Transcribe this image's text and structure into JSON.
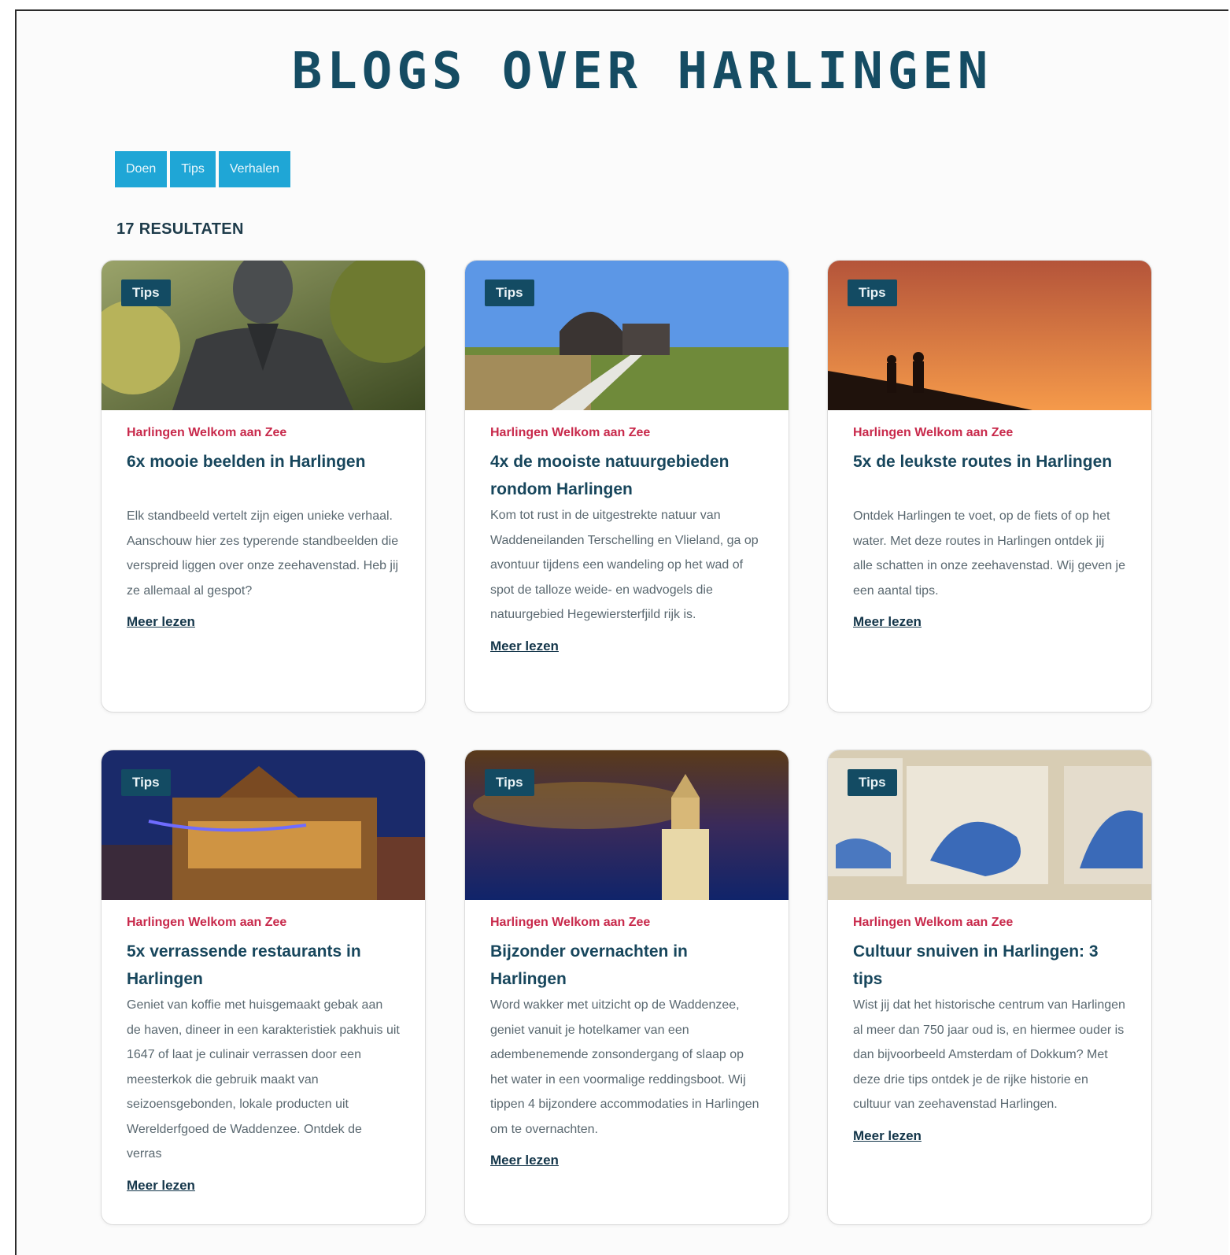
{
  "page": {
    "title": "BLOGS OVER HARLINGEN"
  },
  "filters": [
    "Doen",
    "Tips",
    "Verhalen"
  ],
  "results": {
    "count_label": "17 RESULTATEN"
  },
  "cards": [
    {
      "badge": "Tips",
      "category": "Harlingen Welkom aan Zee",
      "title": "6x mooie beelden in Harlingen",
      "description": "Elk standbeeld vertelt zijn eigen unieke verhaal. Aanschouw hier zes typerende standbeelden die verspreid liggen over onze zeehavenstad. Heb jij ze allemaal al gespot?",
      "link": "Meer lezen",
      "image": "bronze-statue"
    },
    {
      "badge": "Tips",
      "category": "Harlingen Welkom aan Zee",
      "title": "4x de mooiste natuurgebieden rondom Harlingen",
      "description": "Kom tot rust in de uitgestrekte natuur van Waddeneilanden Terschelling en Vlieland, ga op avontuur tijdens een wandeling op het wad of spot de talloze weide- en wadvogels die natuurgebied Hegewiersterfjild rijk is.",
      "link": "Meer lezen",
      "image": "nature-pavilion"
    },
    {
      "badge": "Tips",
      "category": "Harlingen Welkom aan Zee",
      "title": "5x de leukste routes in Harlingen",
      "description": "Ontdek Harlingen te voet, op de fiets of op het water. Met deze routes in Harlingen ontdek jij alle schatten in onze zeehavenstad. Wij geven je een aantal tips.",
      "link": "Meer lezen",
      "image": "sunset-walkers"
    },
    {
      "badge": "Tips",
      "category": "Harlingen Welkom aan Zee",
      "title": "5x verrassende restaurants in Harlingen",
      "description": "Geniet van koffie met huisgemaakt gebak aan de haven, dineer in een karakteristiek pakhuis uit 1647 of laat je culinair verrassen door een meesterkok die gebruik maakt van seizoensgebonden, lokale producten uit Werelderfgoed de Waddenzee. Ontdek de verras",
      "link": "Meer lezen",
      "image": "night-buildings"
    },
    {
      "badge": "Tips",
      "category": "Harlingen Welkom aan Zee",
      "title": "Bijzonder overnachten in Harlingen",
      "description": "Word wakker met uitzicht op de Waddenzee, geniet vanuit je hotelkamer van een adembenemende zonsondergang of slaap op het water in een voormalige reddingsboot. Wij tippen 4 bijzondere accommodaties in Harlingen om te overnachten.",
      "link": "Meer lezen",
      "image": "lighthouse-night"
    },
    {
      "badge": "Tips",
      "category": "Harlingen Welkom aan Zee",
      "title": "Cultuur snuiven in Harlingen: 3 tips",
      "description": "Wist jij dat het historische centrum van Harlingen al meer dan 750 jaar oud is, en hiermee ouder is dan bijvoorbeeld Amsterdam of Dokkum? Met deze drie tips ontdek je de rijke historie en cultuur van zeehavenstad Harlingen.",
      "link": "Meer lezen",
      "image": "delft-tiles"
    }
  ]
}
